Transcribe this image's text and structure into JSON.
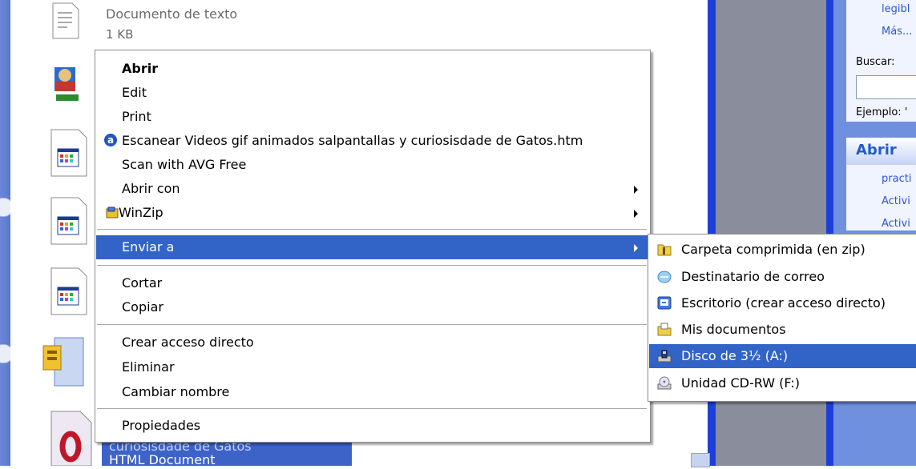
{
  "background": {
    "file_name_label": "Documento de texto",
    "file_size": "1 KB",
    "selected_file_name": "curiosisdade de Gatos",
    "selected_file_type": "HTML Document"
  },
  "right_pane": {
    "link_legible": "legibl",
    "link_more": "Más...",
    "search_label": "Buscar:",
    "example_label": "Ejemplo: '",
    "section_title": "Abrir",
    "links": [
      "practi",
      "Activi",
      "Activi"
    ]
  },
  "context_menu": {
    "items": [
      {
        "label": "Abrir",
        "bold": true
      },
      {
        "label": "Edit"
      },
      {
        "label": "Print"
      },
      {
        "label": "Escanear Videos gif animados salpantallas y curiosisdade de Gatos.htm",
        "icon": "avast-scan-icon"
      },
      {
        "label": "Scan with AVG Free"
      },
      {
        "label": "Abrir con",
        "submenu": true
      },
      {
        "label": "WinZip",
        "submenu": true,
        "icon": "winzip-icon"
      },
      {
        "label": "Enviar a",
        "submenu": true,
        "highlighted": true
      },
      {
        "label": "Cortar"
      },
      {
        "label": "Copiar"
      },
      {
        "label": "Crear acceso directo"
      },
      {
        "label": "Eliminar"
      },
      {
        "label": "Cambiar nombre"
      },
      {
        "label": "Propiedades"
      }
    ]
  },
  "send_to_menu": {
    "items": [
      {
        "label": "Carpeta comprimida (en zip)",
        "icon": "zip-folder-icon"
      },
      {
        "label": "Destinatario de correo",
        "icon": "mail-recipient-icon"
      },
      {
        "label": "Escritorio (crear acceso directo)",
        "icon": "desktop-shortcut-icon"
      },
      {
        "label": "Mis documentos",
        "icon": "my-documents-icon"
      },
      {
        "label": "Disco de 3½ (A:)",
        "icon": "floppy-drive-icon",
        "highlighted": true
      },
      {
        "label": "Unidad CD-RW (F:)",
        "icon": "cd-drive-icon"
      }
    ]
  },
  "colors": {
    "highlight": "#3264c8",
    "xp_blue": "#1d3fd9",
    "pane_blue": "#6f8fdf"
  }
}
